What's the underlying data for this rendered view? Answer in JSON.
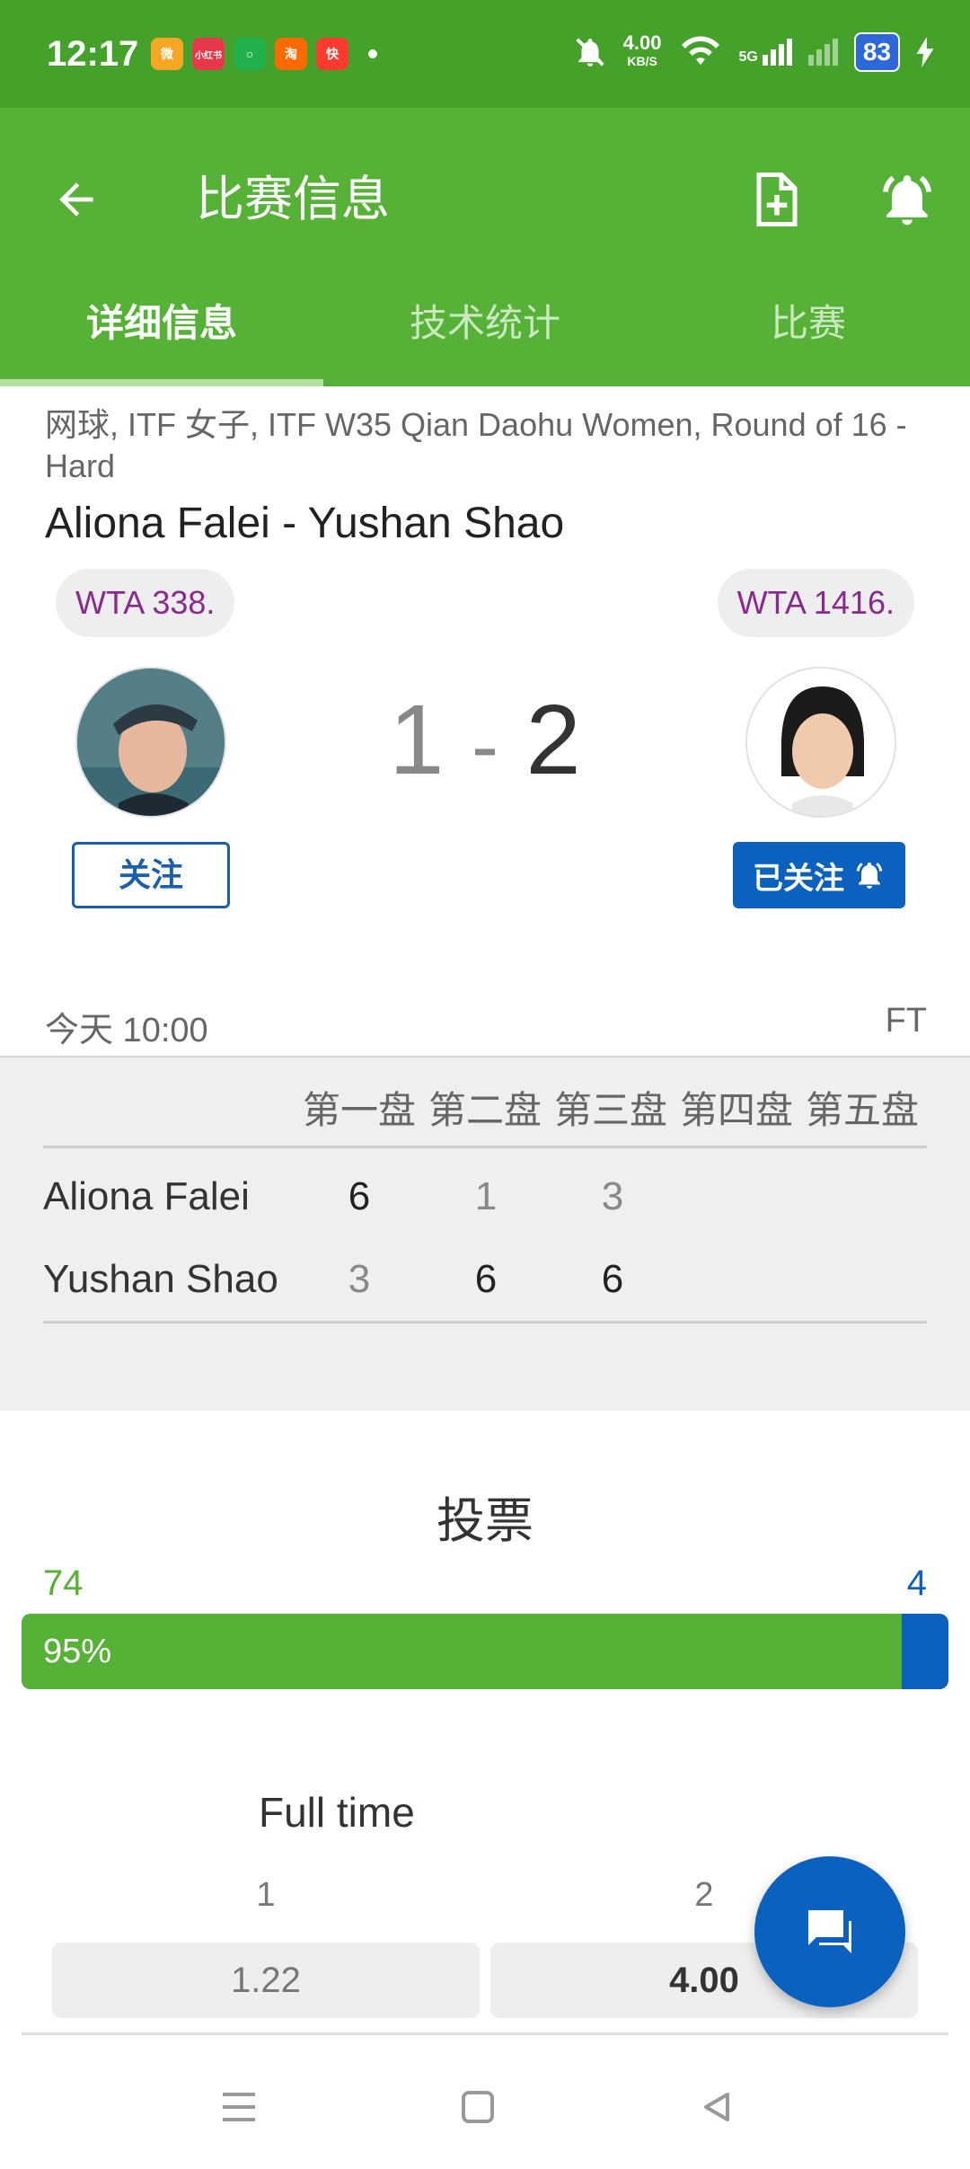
{
  "status_bar": {
    "time": "12:17",
    "net_speed": "4.00",
    "net_unit": "KB/S",
    "signal_label": "5G",
    "battery": "83",
    "notifications": [
      {
        "name": "weibo-icon",
        "color": "#f5a623",
        "text": "微"
      },
      {
        "name": "xiaohongshu-icon",
        "color": "#e8374b",
        "text": "小红书"
      },
      {
        "name": "green-app-icon",
        "color": "#22b14c",
        "text": "○"
      },
      {
        "name": "orange-app-icon",
        "color": "#ff6a00",
        "text": "淘"
      },
      {
        "name": "video-app-icon",
        "color": "#ff3b30",
        "text": "快"
      }
    ]
  },
  "header": {
    "title": "比赛信息",
    "tabs": [
      {
        "label": "详细信息",
        "active": true
      },
      {
        "label": "技术统计",
        "active": false
      },
      {
        "label": "比赛",
        "active": false
      }
    ]
  },
  "match": {
    "competition": "网球, ITF 女子, ITF W35 Qian Daohu Women, Round of 16 - Hard",
    "title": "Aliona Falei - Yushan Shao",
    "home": {
      "rank": "WTA 338.",
      "follow_label": "关注"
    },
    "away": {
      "rank": "WTA 1416.",
      "follow_label": "已关注"
    },
    "score_home": "1",
    "score_sep": "-",
    "score_away": "2",
    "start_time": "今天 10:00",
    "status": "FT"
  },
  "sets": {
    "headers": [
      "第一盘",
      "第二盘",
      "第三盘",
      "第四盘",
      "第五盘"
    ],
    "rows": [
      {
        "name": "Aliona Falei",
        "scores": [
          "6",
          "1",
          "3"
        ]
      },
      {
        "name": "Yushan Shao",
        "scores": [
          "3",
          "6",
          "6"
        ]
      }
    ]
  },
  "vote": {
    "title": "投票",
    "home_votes": "74",
    "away_votes": "4",
    "home_percent_label": "95%",
    "home_fraction": 0.95
  },
  "odds": {
    "title": "Full time",
    "label_1": "1",
    "label_2": "2",
    "value_1": "1.22",
    "value_2": "4.00"
  },
  "colors": {
    "green": "#55b236",
    "dark_green": "#44a12a",
    "blue": "#0b61be",
    "rank_purple": "#8a2a8e"
  }
}
